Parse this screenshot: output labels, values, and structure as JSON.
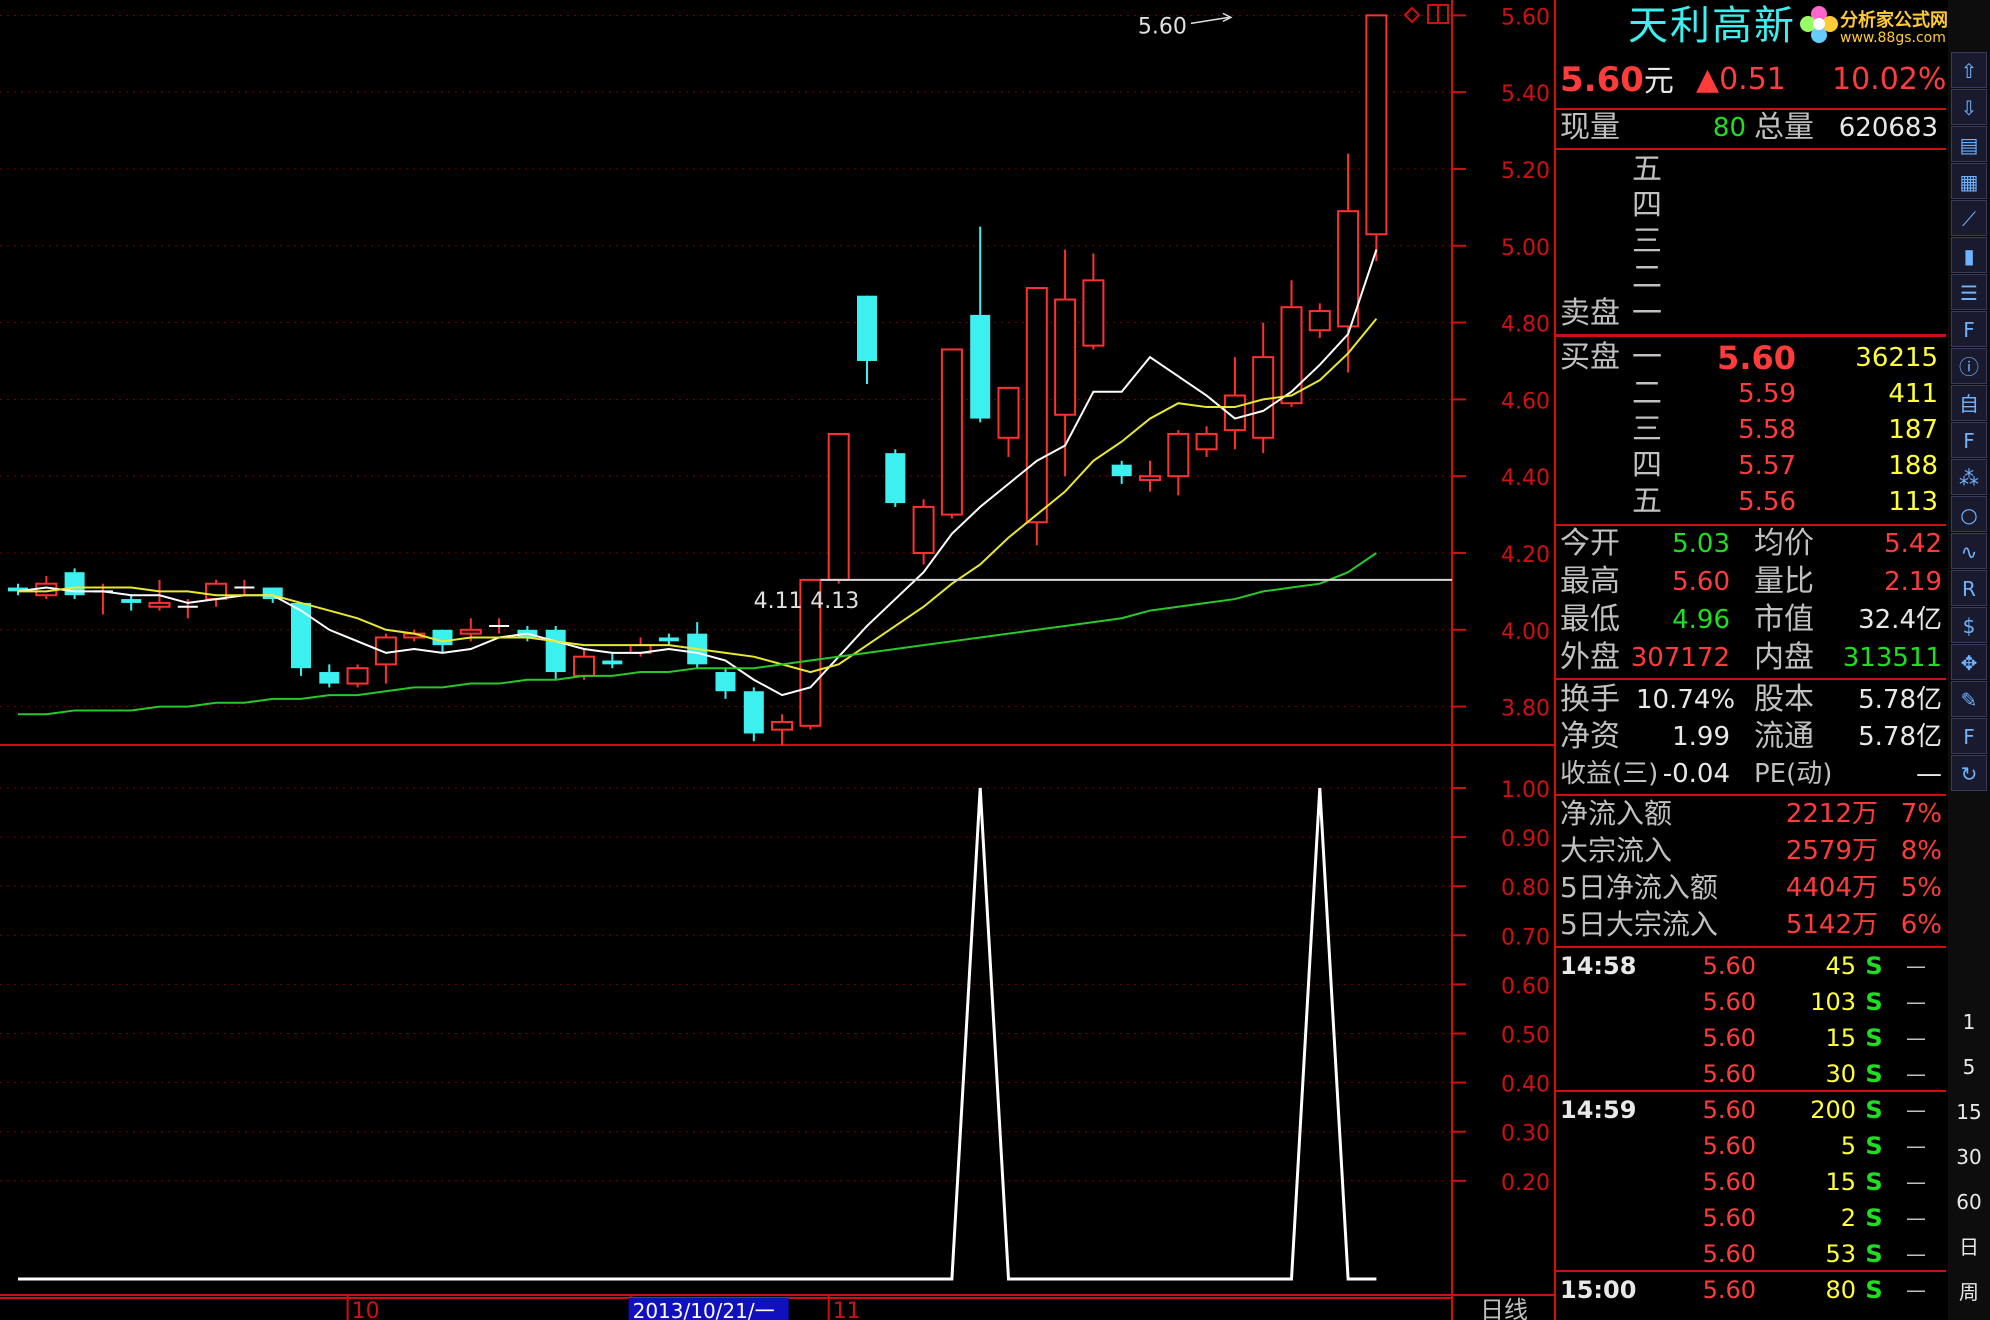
{
  "stock": {
    "name": "天利高新",
    "price": "5.60",
    "price_unit": "元",
    "change": "▲0.51",
    "change_pct": "10.02%"
  },
  "brand": {
    "name": "分析家公式网",
    "url": "www.88gs.com"
  },
  "volume": {
    "cur_label": "现量",
    "cur": "80",
    "total_label": "总量",
    "total": "620683"
  },
  "sell": {
    "label": "卖盘",
    "levels": [
      "五",
      "四",
      "三",
      "二",
      "一"
    ]
  },
  "buy": {
    "label": "买盘",
    "levels": [
      {
        "name": "一",
        "price": "5.60",
        "vol": "36215"
      },
      {
        "name": "二",
        "price": "5.59",
        "vol": "411"
      },
      {
        "name": "三",
        "price": "5.58",
        "vol": "187"
      },
      {
        "name": "四",
        "price": "5.57",
        "vol": "188"
      },
      {
        "name": "五",
        "price": "5.56",
        "vol": "113"
      }
    ]
  },
  "stats": [
    {
      "l1": "今开",
      "v1": "5.03",
      "l2": "均价",
      "v2": "5.42"
    },
    {
      "l1": "最高",
      "v1": "5.60",
      "l2": "量比",
      "v2": "2.19"
    },
    {
      "l1": "最低",
      "v1": "4.96",
      "l2": "市值",
      "v2": "32.4亿"
    },
    {
      "l1": "外盘",
      "v1": "307172",
      "l2": "内盘",
      "v2": "313511"
    }
  ],
  "fund": [
    {
      "l1": "换手",
      "v1": "10.74%",
      "l2": "股本",
      "v2": "5.78亿"
    },
    {
      "l1": "净资",
      "v1": "1.99",
      "l2": "流通",
      "v2": "5.78亿"
    },
    {
      "l1": "收益(三)",
      "v1": "-0.04",
      "l2": "PE(动)",
      "v2": "—"
    }
  ],
  "flow": [
    {
      "label": "净流入额",
      "value": "2212万",
      "pct": "7%"
    },
    {
      "label": "大宗流入",
      "value": "2579万",
      "pct": "8%"
    },
    {
      "label": "5日净流入额",
      "value": "4404万",
      "pct": "5%"
    },
    {
      "label": "5日大宗流入",
      "value": "5142万",
      "pct": "6%"
    }
  ],
  "ticks": [
    {
      "time": "14:58",
      "price": "5.60",
      "vol": "45",
      "side": "S",
      "flag": "—"
    },
    {
      "time": "",
      "price": "5.60",
      "vol": "103",
      "side": "S",
      "flag": "—"
    },
    {
      "time": "",
      "price": "5.60",
      "vol": "15",
      "side": "S",
      "flag": "—"
    },
    {
      "time": "",
      "price": "5.60",
      "vol": "30",
      "side": "S",
      "flag": "—"
    },
    {
      "time": "14:59",
      "price": "5.60",
      "vol": "200",
      "side": "S",
      "flag": "—"
    },
    {
      "time": "",
      "price": "5.60",
      "vol": "5",
      "side": "S",
      "flag": "—"
    },
    {
      "time": "",
      "price": "5.60",
      "vol": "15",
      "side": "S",
      "flag": "—"
    },
    {
      "time": "",
      "price": "5.60",
      "vol": "2",
      "side": "S",
      "flag": "—"
    },
    {
      "time": "",
      "price": "5.60",
      "vol": "53",
      "side": "S",
      "flag": "—"
    },
    {
      "time": "15:00",
      "price": "5.60",
      "vol": "80",
      "side": "S",
      "flag": "—"
    }
  ],
  "axis": {
    "period": "日线",
    "dates": [
      {
        "label": "10",
        "idx": 12
      },
      {
        "label": "2013/10/21/一",
        "idx": 22,
        "highlight": true
      },
      {
        "label": "11",
        "idx": 29
      }
    ]
  },
  "toolbar": {
    "icons": [
      "up-arrow-icon",
      "down-arrow-icon",
      "report-icon",
      "grid-icon",
      "line-chart-icon",
      "candle-icon",
      "list-icon",
      "f10-icon",
      "info-icon",
      "self-select-icon",
      "f2-icon",
      "chart-70-icon",
      "circle-icon",
      "wave-icon",
      "rsi-icon",
      "money-icon",
      "move-icon",
      "pencil-icon",
      "f5-icon",
      "refresh-icon"
    ],
    "labels": [
      "1",
      "5",
      "15",
      "30",
      "60",
      "日",
      "周"
    ]
  },
  "chart_data": [
    {
      "type": "candlestick",
      "title": "",
      "ylim": [
        3.7,
        5.64
      ],
      "y_ticks": [
        5.6,
        5.4,
        5.2,
        5.0,
        4.8,
        4.6,
        4.4,
        4.2,
        4.0,
        3.8
      ],
      "annotations": [
        {
          "text": "5.60",
          "idx": 43,
          "value": 5.6
        },
        {
          "text": "4.11",
          "idx": 27,
          "value": 4.11
        },
        {
          "text": "4.13",
          "idx": 29,
          "value": 4.13
        }
      ],
      "reference_line": 4.13,
      "candles": [
        {
          "o": 4.11,
          "c": 4.1,
          "h": 4.12,
          "l": 4.09
        },
        {
          "o": 4.09,
          "c": 4.12,
          "h": 4.14,
          "l": 4.08
        },
        {
          "o": 4.15,
          "c": 4.09,
          "h": 4.16,
          "l": 4.08
        },
        {
          "o": 4.1,
          "c": 4.1,
          "h": 4.12,
          "l": 4.04
        },
        {
          "o": 4.08,
          "c": 4.07,
          "h": 4.09,
          "l": 4.05
        },
        {
          "o": 4.06,
          "c": 4.07,
          "h": 4.13,
          "l": 4.05
        },
        {
          "o": 4.06,
          "c": 4.06,
          "h": 4.08,
          "l": 4.03
        },
        {
          "o": 4.08,
          "c": 4.12,
          "h": 4.13,
          "l": 4.06
        },
        {
          "o": 4.11,
          "c": 4.11,
          "h": 4.13,
          "l": 4.09
        },
        {
          "o": 4.11,
          "c": 4.08,
          "h": 4.11,
          "l": 4.07
        },
        {
          "o": 4.07,
          "c": 3.9,
          "h": 4.07,
          "l": 3.88
        },
        {
          "o": 3.89,
          "c": 3.86,
          "h": 3.91,
          "l": 3.85
        },
        {
          "o": 3.86,
          "c": 3.9,
          "h": 3.91,
          "l": 3.85
        },
        {
          "o": 3.91,
          "c": 3.98,
          "h": 3.99,
          "l": 3.86
        },
        {
          "o": 3.98,
          "c": 3.99,
          "h": 4.0,
          "l": 3.97
        },
        {
          "o": 4.0,
          "c": 3.96,
          "h": 4.0,
          "l": 3.94
        },
        {
          "o": 3.99,
          "c": 4.0,
          "h": 4.03,
          "l": 3.97
        },
        {
          "o": 4.01,
          "c": 4.01,
          "h": 4.03,
          "l": 3.99
        },
        {
          "o": 4.0,
          "c": 3.98,
          "h": 4.01,
          "l": 3.97
        },
        {
          "o": 4.0,
          "c": 3.89,
          "h": 4.01,
          "l": 3.87
        },
        {
          "o": 3.88,
          "c": 3.93,
          "h": 3.95,
          "l": 3.87
        },
        {
          "o": 3.92,
          "c": 3.91,
          "h": 3.94,
          "l": 3.9
        },
        {
          "o": 3.94,
          "c": 3.96,
          "h": 3.98,
          "l": 3.93
        },
        {
          "o": 3.98,
          "c": 3.97,
          "h": 3.99,
          "l": 3.96
        },
        {
          "o": 3.99,
          "c": 3.91,
          "h": 4.02,
          "l": 3.9
        },
        {
          "o": 3.89,
          "c": 3.84,
          "h": 3.9,
          "l": 3.82
        },
        {
          "o": 3.84,
          "c": 3.73,
          "h": 3.85,
          "l": 3.71
        },
        {
          "o": 3.74,
          "c": 3.76,
          "h": 3.78,
          "l": 3.7
        },
        {
          "o": 3.75,
          "c": 4.13,
          "h": 4.13,
          "l": 3.74
        },
        {
          "o": 4.13,
          "c": 4.51,
          "h": 4.51,
          "l": 4.12
        },
        {
          "o": 4.87,
          "c": 4.7,
          "h": 4.87,
          "l": 4.64
        },
        {
          "o": 4.46,
          "c": 4.33,
          "h": 4.47,
          "l": 4.32
        },
        {
          "o": 4.2,
          "c": 4.32,
          "h": 4.34,
          "l": 4.17
        },
        {
          "o": 4.3,
          "c": 4.73,
          "h": 4.73,
          "l": 4.29
        },
        {
          "o": 4.82,
          "c": 4.55,
          "h": 5.05,
          "l": 4.54
        },
        {
          "o": 4.5,
          "c": 4.63,
          "h": 4.63,
          "l": 4.45
        },
        {
          "o": 4.28,
          "c": 4.89,
          "h": 4.89,
          "l": 4.22
        },
        {
          "o": 4.56,
          "c": 4.86,
          "h": 4.99,
          "l": 4.4
        },
        {
          "o": 4.74,
          "c": 4.91,
          "h": 4.98,
          "l": 4.73
        },
        {
          "o": 4.43,
          "c": 4.4,
          "h": 4.44,
          "l": 4.38
        },
        {
          "o": 4.39,
          "c": 4.4,
          "h": 4.44,
          "l": 4.36
        },
        {
          "o": 4.4,
          "c": 4.51,
          "h": 4.52,
          "l": 4.35
        },
        {
          "o": 4.47,
          "c": 4.51,
          "h": 4.53,
          "l": 4.45
        },
        {
          "o": 4.52,
          "c": 4.61,
          "h": 4.71,
          "l": 4.47
        },
        {
          "o": 4.5,
          "c": 4.71,
          "h": 4.8,
          "l": 4.46
        },
        {
          "o": 4.59,
          "c": 4.84,
          "h": 4.91,
          "l": 4.58
        },
        {
          "o": 4.78,
          "c": 4.83,
          "h": 4.85,
          "l": 4.76
        },
        {
          "o": 4.79,
          "c": 5.09,
          "h": 5.24,
          "l": 4.67
        },
        {
          "o": 5.03,
          "c": 5.6,
          "h": 5.6,
          "l": 4.96
        }
      ],
      "series": [
        {
          "name": "",
          "color": "#ffffff",
          "values": [
            4.1,
            4.11,
            4.1,
            4.1,
            4.09,
            4.09,
            4.07,
            4.08,
            4.09,
            4.09,
            4.05,
            4.0,
            3.97,
            3.94,
            3.95,
            3.94,
            3.95,
            3.98,
            3.99,
            3.97,
            3.95,
            3.94,
            3.94,
            3.95,
            3.94,
            3.92,
            3.87,
            3.83,
            3.85,
            3.93,
            4.01,
            4.08,
            4.15,
            4.25,
            4.32,
            4.38,
            4.44,
            4.48,
            4.62,
            4.62,
            4.71,
            4.66,
            4.61,
            4.55,
            4.57,
            4.62,
            4.69,
            4.77,
            4.99
          ]
        },
        {
          "name": "",
          "color": "#e8e830",
          "values": [
            4.1,
            4.1,
            4.11,
            4.11,
            4.11,
            4.1,
            4.1,
            4.09,
            4.09,
            4.09,
            4.07,
            4.05,
            4.03,
            4.0,
            3.99,
            3.97,
            3.98,
            3.98,
            3.98,
            3.97,
            3.96,
            3.96,
            3.96,
            3.96,
            3.95,
            3.94,
            3.93,
            3.91,
            3.89,
            3.91,
            3.96,
            4.01,
            4.06,
            4.12,
            4.17,
            4.24,
            4.3,
            4.36,
            4.44,
            4.49,
            4.55,
            4.59,
            4.58,
            4.58,
            4.6,
            4.61,
            4.65,
            4.72,
            4.81
          ]
        },
        {
          "name": "",
          "color": "#28c828",
          "values": [
            3.78,
            3.78,
            3.79,
            3.79,
            3.79,
            3.8,
            3.8,
            3.81,
            3.81,
            3.82,
            3.82,
            3.83,
            3.83,
            3.84,
            3.85,
            3.85,
            3.86,
            3.86,
            3.87,
            3.87,
            3.88,
            3.88,
            3.89,
            3.89,
            3.9,
            3.9,
            3.9,
            3.91,
            3.92,
            3.93,
            3.94,
            3.95,
            3.96,
            3.97,
            3.98,
            3.99,
            4.0,
            4.01,
            4.02,
            4.03,
            4.05,
            4.06,
            4.07,
            4.08,
            4.1,
            4.11,
            4.12,
            4.15,
            4.2
          ]
        }
      ]
    },
    {
      "type": "line",
      "title": "",
      "ylim": [
        0,
        1.0
      ],
      "y_ticks": [
        1.0,
        0.9,
        0.8,
        0.7,
        0.6,
        0.5,
        0.4,
        0.3,
        0.2
      ],
      "x": [
        0,
        1,
        2,
        3,
        4,
        5,
        6,
        7,
        8,
        9,
        10,
        11,
        12,
        13,
        14,
        15,
        16,
        17,
        18,
        19,
        20,
        21,
        22,
        23,
        24,
        25,
        26,
        27,
        28,
        29,
        30,
        31,
        32,
        33,
        34,
        35,
        36,
        37,
        38,
        39,
        40,
        41,
        42,
        43,
        44,
        45,
        46,
        47,
        48
      ],
      "series": [
        {
          "name": "",
          "color": "#ffffff",
          "values": [
            0,
            0,
            0,
            0,
            0,
            0,
            0,
            0,
            0,
            0,
            0,
            0,
            0,
            0,
            0,
            0,
            0,
            0,
            0,
            0,
            0,
            0,
            0,
            0,
            0,
            0,
            0,
            0,
            0,
            0,
            0,
            0,
            0,
            0,
            1,
            0,
            0,
            0,
            0,
            0,
            0,
            0,
            0,
            0,
            0,
            0,
            1,
            0,
            0
          ]
        }
      ]
    }
  ]
}
